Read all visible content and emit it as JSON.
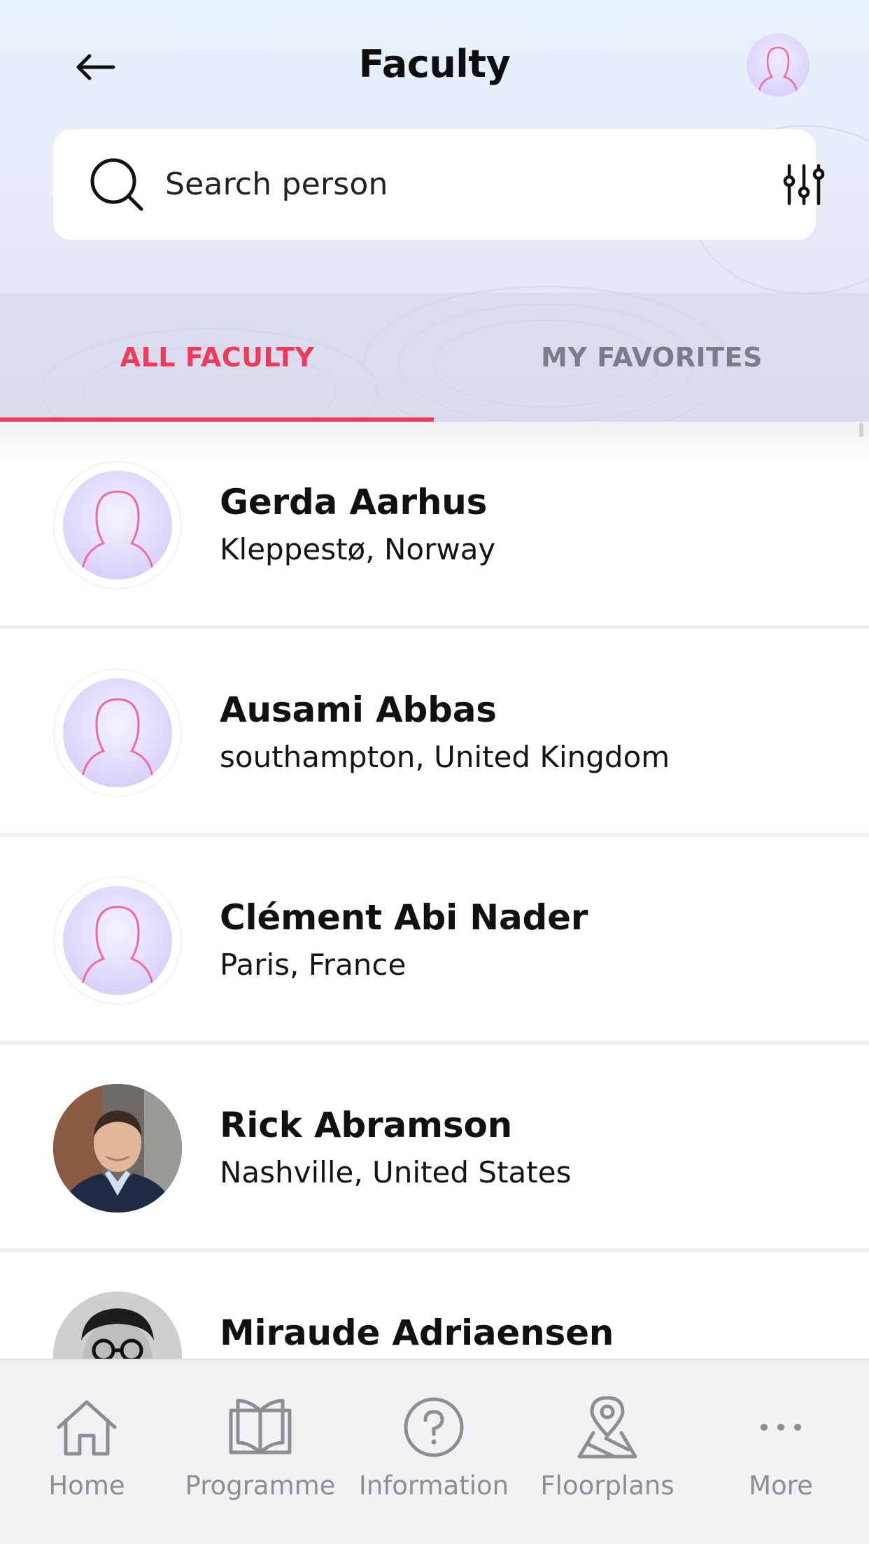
{
  "header": {
    "title": "Faculty",
    "back_icon": "arrow-left-icon",
    "profile_icon": "user-avatar-icon"
  },
  "search": {
    "placeholder": "Search person",
    "search_icon": "search-icon",
    "filter_icon": "filter-sliders-icon"
  },
  "tabs": [
    {
      "label": "ALL FACULTY",
      "active": true
    },
    {
      "label": "MY FAVORITES",
      "active": false
    }
  ],
  "faculty": [
    {
      "name": "Gerda Aarhus",
      "location": "Kleppestø, Norway",
      "avatar": "placeholder"
    },
    {
      "name": "Ausami Abbas",
      "location": "southampton, United Kingdom",
      "avatar": "placeholder"
    },
    {
      "name": "Clément Abi Nader",
      "location": "Paris, France",
      "avatar": "placeholder"
    },
    {
      "name": "Rick Abramson",
      "location": "Nashville, United States",
      "avatar": "photo"
    },
    {
      "name": "Miraude Adriaensen",
      "location": "",
      "avatar": "photo"
    }
  ],
  "bottom_nav": [
    {
      "label": "Home",
      "icon": "home-icon"
    },
    {
      "label": "Programme",
      "icon": "book-icon"
    },
    {
      "label": "Information",
      "icon": "question-circle-icon"
    },
    {
      "label": "Floorplans",
      "icon": "map-pin-icon"
    },
    {
      "label": "More",
      "icon": "more-dots-icon"
    }
  ],
  "colors": {
    "accent": "#f03a5a",
    "inactive_tab": "#7c7c86",
    "nav_gray": "#8d8d92"
  }
}
